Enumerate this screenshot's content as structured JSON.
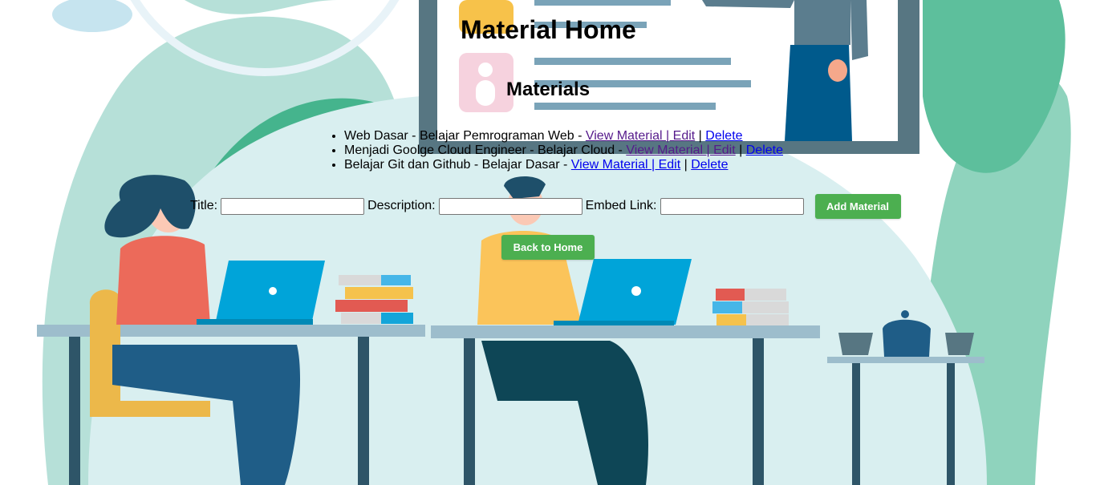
{
  "page_title": "Material Home",
  "section_title": "Materials",
  "materials": [
    {
      "title": "Web Dasar",
      "description": "Belajar Pemrograman Web",
      "view_label": "View Material | Edit",
      "delete_label": "Delete"
    },
    {
      "title": "Menjadi Goolge Cloud Engineer",
      "description": "Belajar Cloud",
      "view_label": "View Material | Edit",
      "delete_label": "Delete"
    },
    {
      "title": "Belajar Git dan Github",
      "description": "Belajar Dasar",
      "view_label": "View Material | Edit",
      "delete_label": "Delete"
    }
  ],
  "separator": "|",
  "form": {
    "title_label": "Title:",
    "title_value": "",
    "description_label": "Description:",
    "description_value": "",
    "embed_label": "Embed Link:",
    "embed_value": "",
    "submit_label": "Add Material"
  },
  "back_button_label": "Back to Home",
  "colors": {
    "button": "#4caf50",
    "link": "#0000ee",
    "visited_link": "#551a8b"
  }
}
